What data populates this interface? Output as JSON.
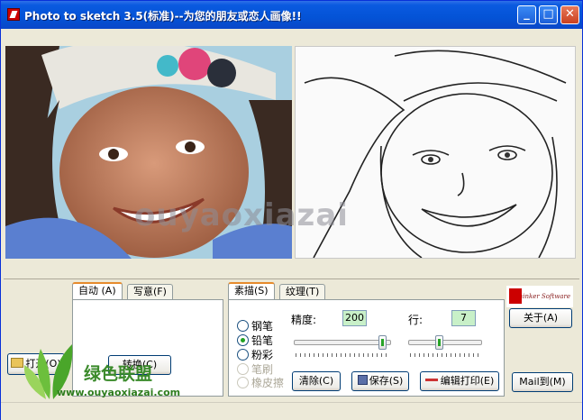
{
  "window": {
    "title": "Photo to sketch 3.5(标准)--为您的朋友或恋人画像!!",
    "buttons": {
      "minimize": "_",
      "maximize": "□",
      "close": "✕"
    }
  },
  "watermark": "ouyaoxiazai",
  "left_tabs": [
    {
      "label": "自动 (A)",
      "active": true
    },
    {
      "label": "写意(F)",
      "active": false
    }
  ],
  "open_button": "打开(O)",
  "convert_button": "转换(C)",
  "right_tabs": [
    {
      "label": "素描(S)",
      "active": true
    },
    {
      "label": "纹理(T)",
      "active": false
    }
  ],
  "styles": [
    {
      "label": "钢笔",
      "checked": false,
      "disabled": false
    },
    {
      "label": "铅笔",
      "checked": true,
      "disabled": false
    },
    {
      "label": "粉彩",
      "checked": false,
      "disabled": false
    },
    {
      "label": "笔刷",
      "checked": false,
      "disabled": true
    },
    {
      "label": "橡皮擦",
      "checked": false,
      "disabled": true
    }
  ],
  "precision": {
    "label": "精度:",
    "value": "200"
  },
  "row": {
    "label": "行:",
    "value": "7"
  },
  "actions": {
    "clear": "清除(C)",
    "save": "保存(S)",
    "edit_print": "编辑打印(E)"
  },
  "about_button": "关于(A)",
  "mail_button": "Mail到(M)",
  "vendor_logo": "Thinker Software",
  "site": {
    "brand": "绿色联盟",
    "url": "www.ouyaoxiazai.com"
  },
  "sliders": {
    "precision_level": 0.97,
    "row_level": 0.42
  },
  "colors": {
    "titlebar": "#0a5ae0",
    "tab_accent": "#e68b2c",
    "input_bg": "#c8f0c8",
    "brand_green": "#3a8a2a"
  },
  "icons": [
    "app-icon",
    "folder-icon",
    "save-disk-icon",
    "print-icon",
    "leaf-logo-icon"
  ]
}
